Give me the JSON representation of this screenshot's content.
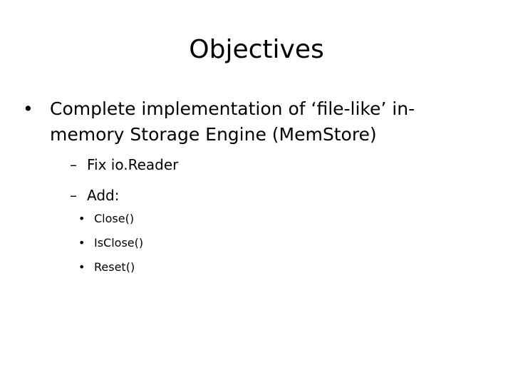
{
  "slide": {
    "title": "Objectives",
    "items": [
      {
        "bullet": "•",
        "text_line1": "Complete implementation of  ‘file-like’ in-",
        "text_line2": "memory Storage Engine (MemStore)",
        "subitems": [
          {
            "bullet": "–",
            "text": "Fix io.Reader"
          },
          {
            "bullet": "–",
            "text": "Add:",
            "subitems": [
              {
                "bullet": "•",
                "text": "Close()"
              },
              {
                "bullet": "•",
                "text": "IsClose()"
              },
              {
                "bullet": "•",
                "text": "Reset()"
              }
            ]
          }
        ]
      }
    ]
  }
}
